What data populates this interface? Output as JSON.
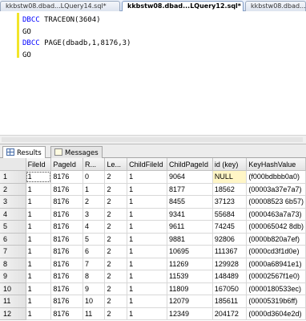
{
  "tabs": [
    {
      "label": "kkbstw08.dbad...LQuery14.sql*",
      "active": false
    },
    {
      "label": "kkbstw08.dbad...LQuery12.sql*",
      "active": true
    },
    {
      "label": "kkbstw08.dbad...",
      "active": false
    }
  ],
  "editor": {
    "lines": [
      [
        {
          "t": "DBCC",
          "kw": true
        },
        {
          "t": " TRACEON(3604)",
          "kw": false
        }
      ],
      [
        {
          "t": "GO",
          "kw": false
        }
      ],
      [
        {
          "t": "DBCC",
          "kw": true
        },
        {
          "t": " PAGE(dbadb,1,8176,3)",
          "kw": false
        }
      ],
      [
        {
          "t": "GO",
          "kw": false
        }
      ]
    ]
  },
  "result_tabs": {
    "results": "Results",
    "messages": "Messages"
  },
  "grid": {
    "columns": [
      "FileId",
      "PageId",
      "R...",
      "Le...",
      "ChildFileId",
      "ChildPageId",
      "id (key)",
      "KeyHashValue"
    ],
    "rows": [
      [
        "1",
        "1",
        "8176",
        "0",
        "2",
        "1",
        "9064",
        "NULL",
        "(f000bdbbb0a0)"
      ],
      [
        "2",
        "1",
        "8176",
        "1",
        "2",
        "1",
        "8177",
        "18562",
        "(00003a37e7a7)"
      ],
      [
        "3",
        "1",
        "8176",
        "2",
        "2",
        "1",
        "8455",
        "37123",
        "(00008523 6b57)"
      ],
      [
        "4",
        "1",
        "8176",
        "3",
        "2",
        "1",
        "9341",
        "55684",
        "(0000463a7a73)"
      ],
      [
        "5",
        "1",
        "8176",
        "4",
        "2",
        "1",
        "9611",
        "74245",
        "(000065042 8db)"
      ],
      [
        "6",
        "1",
        "8176",
        "5",
        "2",
        "1",
        "9881",
        "92806",
        "(0000b820a7ef)"
      ],
      [
        "7",
        "1",
        "8176",
        "6",
        "2",
        "1",
        "10695",
        "111367",
        "(0000cd3f1d0e)"
      ],
      [
        "8",
        "1",
        "8176",
        "7",
        "2",
        "1",
        "11269",
        "129928",
        "(0000a68941e1)"
      ],
      [
        "9",
        "1",
        "8176",
        "8",
        "2",
        "1",
        "11539",
        "148489",
        "(00002567f1e0)"
      ],
      [
        "10",
        "1",
        "8176",
        "9",
        "2",
        "1",
        "11809",
        "167050",
        "(0000180533ec)"
      ],
      [
        "11",
        "1",
        "8176",
        "10",
        "2",
        "1",
        "12079",
        "185611",
        "(00005319b6ff)"
      ],
      [
        "12",
        "1",
        "8176",
        "11",
        "2",
        "1",
        "12349",
        "204172",
        "(0000d3604e2d)"
      ]
    ]
  }
}
